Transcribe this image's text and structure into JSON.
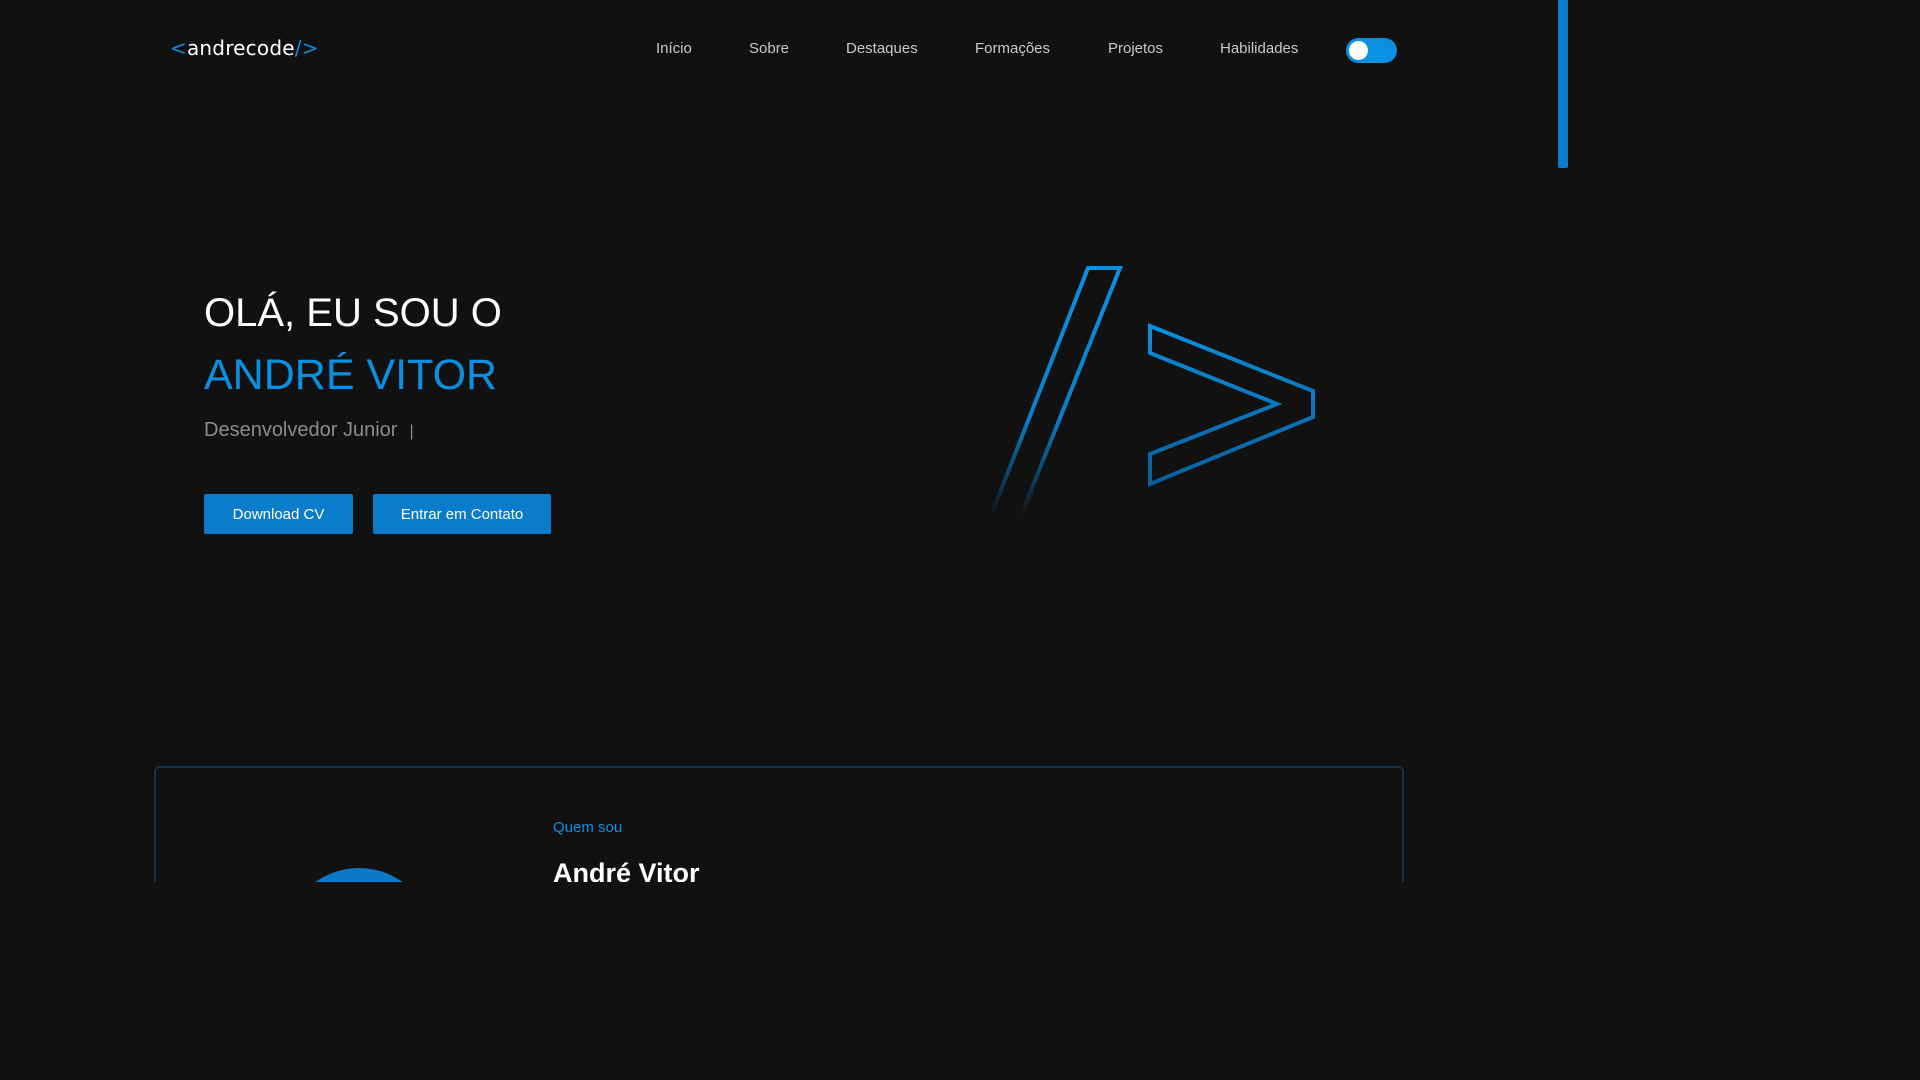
{
  "logo": {
    "open": "<",
    "name": "andrecode",
    "close": "/>"
  },
  "nav": {
    "items": [
      {
        "label": "Início"
      },
      {
        "label": "Sobre"
      },
      {
        "label": "Destaques"
      },
      {
        "label": "Formações"
      },
      {
        "label": "Projetos"
      },
      {
        "label": "Habilidades"
      }
    ],
    "theme_toggle_on": true
  },
  "hero": {
    "greeting": "OLÁ, EU SOU O",
    "name": "ANDRÉ VITOR",
    "role": "Desenvolvedor Junior",
    "caret": "|",
    "buttons": {
      "download": "Download CV",
      "contact": "Entrar em Contato"
    },
    "graphic_icon": "code-slash-chevron-icon"
  },
  "about": {
    "tag": "Quem sou",
    "name": "André Vitor"
  },
  "colors": {
    "background": "#111111",
    "accent": "#0a90e3",
    "button": "#0b7ccc",
    "text": "#ffffff",
    "muted": "#8c8c8c"
  }
}
